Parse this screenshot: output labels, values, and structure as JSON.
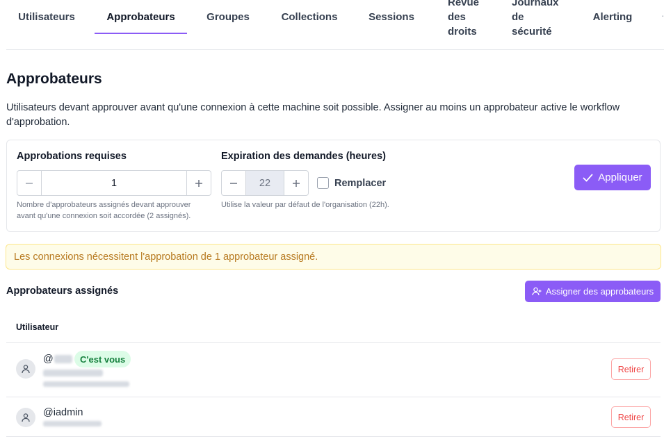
{
  "tabs": [
    {
      "label": "Utilisateurs",
      "active": false
    },
    {
      "label": "Approbateurs",
      "active": true
    },
    {
      "label": "Groupes",
      "active": false
    },
    {
      "label": "Collections",
      "active": false
    },
    {
      "label": "Sessions",
      "active": false
    },
    {
      "label": "Revue\ndes\ndroits",
      "active": false
    },
    {
      "label": "Journaux\nde\nsécurité",
      "active": false
    },
    {
      "label": "Alerting",
      "active": false
    }
  ],
  "page": {
    "title": "Approbateurs",
    "description": "Utilisateurs devant approuver avant qu'une connexion à cette machine soit possible. Assigner au moins un approbateur active le workflow d'approbation."
  },
  "settings": {
    "required": {
      "label": "Approbations requises",
      "value": "1",
      "hint": "Nombre d'approbateurs assignés devant approuver avant qu'une connexion soit accordée (2 assignés)."
    },
    "expiration": {
      "label": "Expiration des demandes (heures)",
      "value": "22",
      "hint": "Utilise la valeur par défaut de l'organisation (22h).",
      "override_label": "Remplacer",
      "override_checked": false
    },
    "apply_label": "Appliquer"
  },
  "alert": {
    "text": "Les connexions nécessitent l'approbation de 1 approbateur assigné."
  },
  "assigned": {
    "title": "Approbateurs assignés",
    "assign_button": "Assigner des approbateurs",
    "column_user": "Utilisateur",
    "rows": [
      {
        "username_prefix": "@",
        "you_badge": "C'est vous",
        "remove_label": "Retirer"
      },
      {
        "username": "@iadmin",
        "remove_label": "Retirer"
      }
    ]
  },
  "colors": {
    "accent": "#8b5cf6",
    "warning_text": "#b7791f",
    "warning_bg": "#fefce8",
    "badge_bg": "#dcfce7",
    "badge_text": "#15803d",
    "danger": "#ef4444"
  }
}
